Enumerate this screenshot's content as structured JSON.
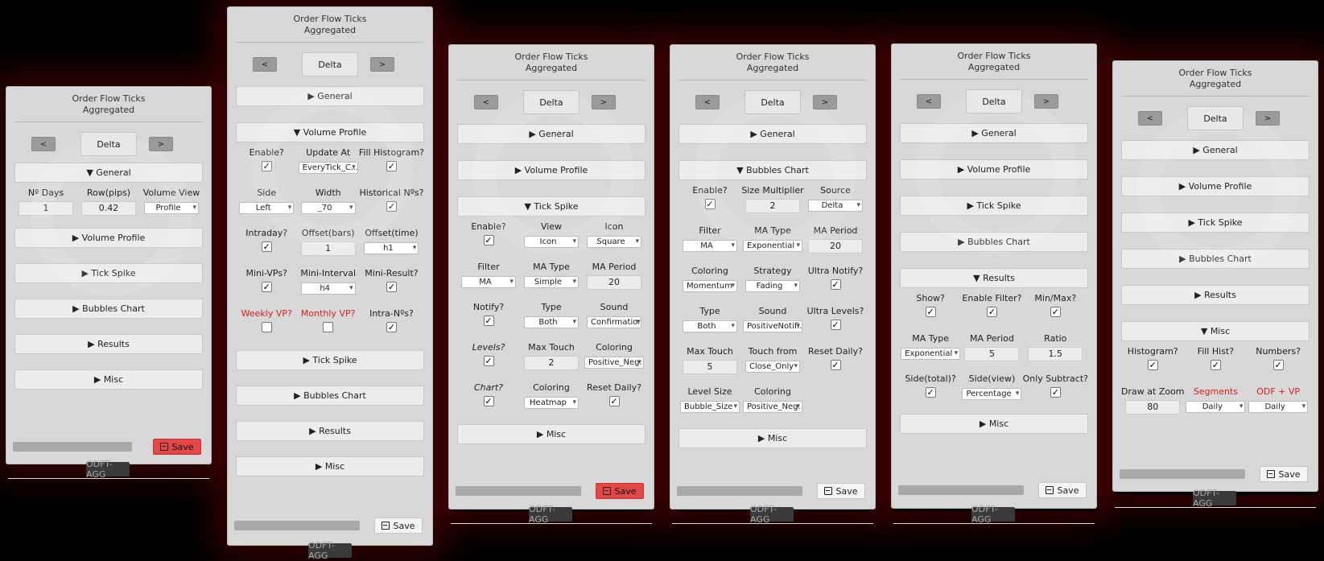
{
  "colors": {
    "accent_red": "#e34747",
    "panel_bg": "#d8d8d8",
    "label_red": "#d6201f"
  },
  "common": {
    "title_line1": "Order Flow Ticks",
    "title_line2": "Aggregated",
    "prev": "<",
    "next": ">",
    "mode": "Delta",
    "badge": "ODFT-AGG",
    "save": "Save",
    "save_icon": "floppy-disk-icon"
  },
  "sections": {
    "general": "General",
    "volume_profile": "Volume Profile",
    "tick_spike": "Tick Spike",
    "bubbles_chart": "Bubbles Chart",
    "results": "Results",
    "misc": "Misc"
  },
  "markers": {
    "collapsed": "▶",
    "expanded": "▼"
  },
  "general": {
    "days_label": "Nº Days",
    "row_label": "Row(pips)",
    "view_label": "Volume View",
    "days": "1",
    "row": "0.42",
    "view": "Profile"
  },
  "volume_profile": {
    "enable_label": "Enable?",
    "update_label": "Update At",
    "fill_label": "Fill Histogram?",
    "update_value": "EveryTick_C...",
    "side_label": "Side",
    "width_label": "Width",
    "historical_label": "Historical Nºs?",
    "side_value": "Left",
    "width_value": "_70",
    "intraday_label": "Intraday?",
    "offset_bars_label": "Offset(bars)",
    "offset_time_label": "Offset(time)",
    "offset_bars_value": "1",
    "offset_time_value": "h1",
    "minivp_label": "Mini-VPs?",
    "mini_interval_label": "Mini-Interval",
    "mini_result_label": "Mini-Result?",
    "mini_interval_value": "h4",
    "weekly_label": "Weekly VP?",
    "monthly_label": "Monthly VP?",
    "intra_label": "Intra-Nºs?"
  },
  "tick_spike": {
    "enable_label": "Enable?",
    "view_label": "View",
    "icon_label": "Icon",
    "view_value": "Icon",
    "icon_value": "Square",
    "filter_label": "Filter",
    "matype_label": "MA Type",
    "maperiod_label": "MA Period",
    "filter_value": "MA",
    "matype_value": "Simple",
    "maperiod_value": "20",
    "notify_label": "Notify?",
    "type_label": "Type",
    "sound_label": "Sound",
    "type_value": "Both",
    "sound_value": "Confirmation",
    "levels_label": "Levels?",
    "maxtouch_label": "Max Touch",
    "coloring_label": "Coloring",
    "maxtouch_value": "2",
    "coloring_value": "Positive_Neg...",
    "chart_label": "Chart?",
    "coloring2_label": "Coloring",
    "reset_label": "Reset Daily?",
    "coloring2_value": "Heatmap"
  },
  "bubbles": {
    "enable_label": "Enable?",
    "size_label": "Size Multiplier",
    "source_label": "Source",
    "size_value": "2",
    "source_value": "Delta",
    "filter_label": "Filter",
    "matype_label": "MA Type",
    "maperiod_label": "MA Period",
    "filter_value": "MA",
    "matype_value": "Exponential",
    "maperiod_value": "20",
    "coloring_label": "Coloring",
    "strategy_label": "Strategy",
    "ultra_notify_label": "Ultra Notify?",
    "coloring_value": "Momentum",
    "strategy_value": "Fading",
    "type_label": "Type",
    "sound_label": "Sound",
    "ultra_levels_label": "Ultra Levels?",
    "type_value": "Both",
    "sound_value": "PositiveNotifi...",
    "maxtouch_label": "Max Touch",
    "touchfrom_label": "Touch from",
    "reset_label": "Reset Daily?",
    "maxtouch_value": "5",
    "touchfrom_value": "Close_Only",
    "levelsize_label": "Level Size",
    "coloring2_label": "Coloring",
    "levelsize_value": "Bubble_Size",
    "coloring2_value": "Positive_Neg..."
  },
  "results": {
    "show_label": "Show?",
    "enable_filter_label": "Enable Filter?",
    "minmax_label": "Min/Max?",
    "matype_label": "MA Type",
    "maperiod_label": "MA Period",
    "ratio_label": "Ratio",
    "matype_value": "Exponential",
    "maperiod_value": "5",
    "ratio_value": "1.5",
    "side_total_label": "Side(total)?",
    "side_view_label": "Side(view)",
    "only_sub_label": "Only Subtract?",
    "side_view_value": "Percentage"
  },
  "misc": {
    "histogram_label": "Histogram?",
    "fillhist_label": "Fill Hist?",
    "numbers_label": "Numbers?",
    "zoom_label": "Draw at Zoom",
    "segments_label": "Segments",
    "odfvp_label": "ODF + VP",
    "zoom_value": "80",
    "segments_value": "Daily",
    "odfvp_value": "Daily"
  }
}
